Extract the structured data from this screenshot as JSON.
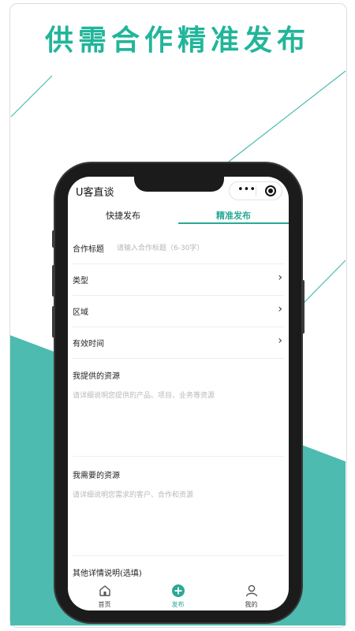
{
  "headline": "供需合作精准发布",
  "app": {
    "title": "U客直谈",
    "capsule_more": "•••"
  },
  "tabs": [
    {
      "label": "快捷发布",
      "active": false
    },
    {
      "label": "精准发布",
      "active": true
    }
  ],
  "form": {
    "title_field": {
      "label": "合作标题",
      "placeholder": "请输入合作标题（6-30字）"
    },
    "type_field": {
      "label": "类型"
    },
    "region_field": {
      "label": "区域"
    },
    "validity_field": {
      "label": "有效时间"
    },
    "provide": {
      "label": "我提供的资源",
      "placeholder": "请详细说明您提供的产品、项目、业务等资源"
    },
    "need": {
      "label": "我需要的资源",
      "placeholder": "请详细说明您需求的客户、合作和资源"
    },
    "other": {
      "label": "其他详情说明(选填)"
    }
  },
  "tabbar": [
    {
      "label": "首页",
      "icon": "home-icon",
      "active": false
    },
    {
      "label": "发布",
      "icon": "add-circle-icon",
      "active": true
    },
    {
      "label": "我的",
      "icon": "user-icon",
      "active": false
    }
  ],
  "colors": {
    "accent": "#2aa996",
    "teal_background": "#4dbbb0",
    "headline": "#22b59a"
  }
}
